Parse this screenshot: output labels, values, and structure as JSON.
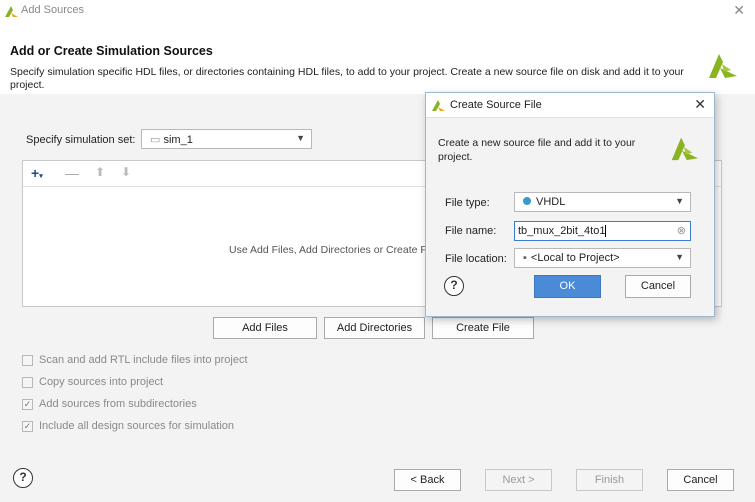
{
  "window": {
    "title": "Add Sources"
  },
  "header": {
    "heading": "Add or Create Simulation Sources",
    "description": "Specify simulation specific HDL files, or directories containing HDL files, to add to your project. Create a new source file on disk and add it to your project."
  },
  "sim_set": {
    "label": "Specify simulation set:",
    "value": "sim_1"
  },
  "list": {
    "hint": "Use Add Files, Add Directories or Create File buttons below"
  },
  "buttons": {
    "add_files": "Add Files",
    "add_directories": "Add Directories",
    "create_file": "Create File"
  },
  "options": [
    {
      "label": "Scan and add RTL include files into project",
      "checked": false
    },
    {
      "label": "Copy sources into project",
      "checked": false
    },
    {
      "label": "Add sources from subdirectories",
      "checked": true
    },
    {
      "label": "Include all design sources for simulation",
      "checked": true
    }
  ],
  "footer": {
    "help": "?",
    "back": "< Back",
    "next": "Next >",
    "finish": "Finish",
    "cancel": "Cancel"
  },
  "dialog": {
    "title": "Create Source File",
    "description": "Create a new source file and add it to your project.",
    "file_type_label": "File type:",
    "file_type_value": "VHDL",
    "file_name_label": "File name:",
    "file_name_value": "tb_mux_2bit_4to1",
    "file_location_label": "File location:",
    "file_location_value": "<Local to Project>",
    "help": "?",
    "ok": "OK",
    "cancel": "Cancel"
  },
  "colors": {
    "accent": "#4b8ad6",
    "vhdl_dot": "#3a9bc4",
    "logo": "#8ab322"
  }
}
